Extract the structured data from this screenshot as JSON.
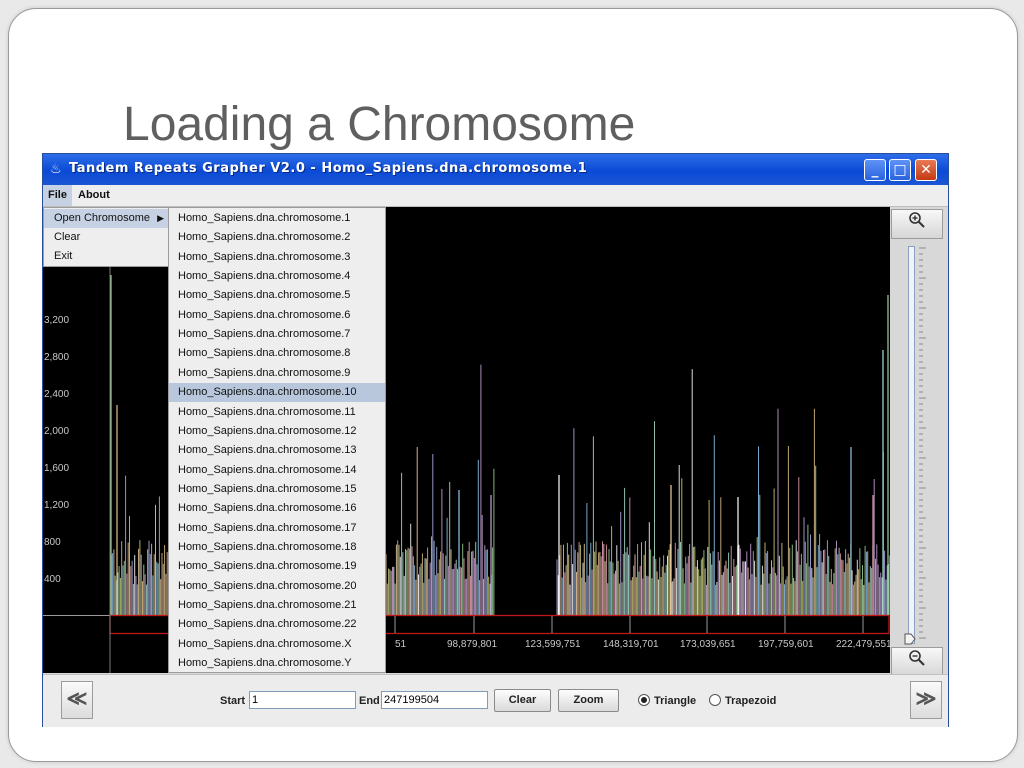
{
  "slide": {
    "title": "Loading a Chromosome"
  },
  "window": {
    "title": "Tandem Repeats Grapher V2.0 - Homo_Sapiens.dna.chromosome.1",
    "app_icon": "java-cup-icon",
    "buttons": {
      "minimize": "_",
      "maximize": "□",
      "close": "✕"
    }
  },
  "menubar": {
    "file": "File",
    "about": "About"
  },
  "file_menu": {
    "items": [
      "Open Chromosome",
      "Clear",
      "Exit"
    ],
    "open_arrow": "▶"
  },
  "chromosome_submenu": {
    "items": [
      "Homo_Sapiens.dna.chromosome.1",
      "Homo_Sapiens.dna.chromosome.2",
      "Homo_Sapiens.dna.chromosome.3",
      "Homo_Sapiens.dna.chromosome.4",
      "Homo_Sapiens.dna.chromosome.5",
      "Homo_Sapiens.dna.chromosome.6",
      "Homo_Sapiens.dna.chromosome.7",
      "Homo_Sapiens.dna.chromosome.8",
      "Homo_Sapiens.dna.chromosome.9",
      "Homo_Sapiens.dna.chromosome.10",
      "Homo_Sapiens.dna.chromosome.11",
      "Homo_Sapiens.dna.chromosome.12",
      "Homo_Sapiens.dna.chromosome.13",
      "Homo_Sapiens.dna.chromosome.14",
      "Homo_Sapiens.dna.chromosome.15",
      "Homo_Sapiens.dna.chromosome.16",
      "Homo_Sapiens.dna.chromosome.17",
      "Homo_Sapiens.dna.chromosome.18",
      "Homo_Sapiens.dna.chromosome.19",
      "Homo_Sapiens.dna.chromosome.20",
      "Homo_Sapiens.dna.chromosome.21",
      "Homo_Sapiens.dna.chromosome.22",
      "Homo_Sapiens.dna.chromosome.X",
      "Homo_Sapiens.dna.chromosome.Y"
    ],
    "highlighted": "Homo_Sapiens.dna.chromosome.10"
  },
  "plot": {
    "y_ticks": [
      "3,200",
      "2,800",
      "2,400",
      "2,000",
      "1,600",
      "1,200",
      "800",
      "400"
    ],
    "x_ticks": [
      "51",
      "98,879,801",
      "123,599,751",
      "148,319,701",
      "173,039,651",
      "197,759,601",
      "222,479,551"
    ],
    "icons": {
      "zoom_in": "zoom-in-icon",
      "zoom_out": "zoom-out-icon"
    }
  },
  "controls": {
    "start_label": "Start",
    "start_value": "1",
    "end_label": "End",
    "end_value": "247199504",
    "clear_button": "Clear",
    "zoom_button": "Zoom",
    "radio_triangle": "Triangle",
    "radio_trapezoid": "Trapezoid",
    "selected_shape": "Triangle",
    "prev_icon": "≪",
    "next_icon": "≫"
  }
}
